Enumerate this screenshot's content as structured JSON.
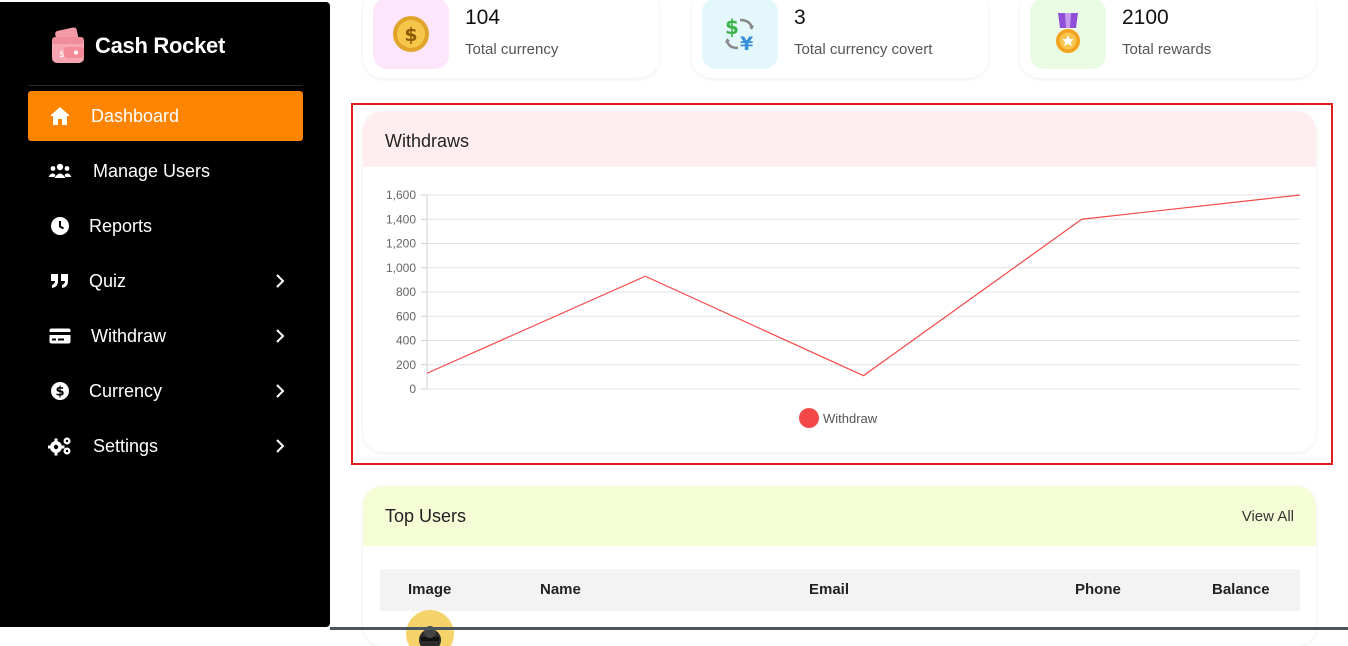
{
  "brand": {
    "name": "Cash Rocket",
    "logo_icon": "wallet-logo-icon"
  },
  "sidebar": {
    "items": [
      {
        "label": "Dashboard",
        "icon": "home-icon",
        "active": true,
        "has_submenu": false
      },
      {
        "label": "Manage Users",
        "icon": "users-icon",
        "active": false,
        "has_submenu": false
      },
      {
        "label": "Reports",
        "icon": "clock-icon",
        "active": false,
        "has_submenu": false
      },
      {
        "label": "Quiz",
        "icon": "quote-icon",
        "active": false,
        "has_submenu": true
      },
      {
        "label": "Withdraw",
        "icon": "credit-card-icon",
        "active": false,
        "has_submenu": true
      },
      {
        "label": "Currency",
        "icon": "dollar-circle-icon",
        "active": false,
        "has_submenu": true
      },
      {
        "label": "Settings",
        "icon": "gears-icon",
        "active": false,
        "has_submenu": true
      }
    ]
  },
  "stats": [
    {
      "value": "104",
      "label": "Total currency",
      "icon": "gold-coin-icon",
      "bg": "#fde6fb"
    },
    {
      "value": "3",
      "label": "Total currency covert",
      "icon": "currency-exchange-icon",
      "bg": "#e4f8fb"
    },
    {
      "value": "2100",
      "label": "Total rewards",
      "icon": "medal-icon",
      "bg": "#eafbe4"
    }
  ],
  "withdraws_panel": {
    "title": "Withdraws",
    "header_bg": "#ffedf0"
  },
  "chart_data": {
    "type": "line",
    "x": [
      1,
      2,
      3,
      4,
      5
    ],
    "series": [
      {
        "name": "Withdraw",
        "values": [
          130,
          930,
          110,
          1400,
          1600
        ],
        "color": "#f44848"
      }
    ],
    "yticks": [
      "1,600",
      "1,400",
      "1,200",
      "1,000",
      "800",
      "600",
      "400",
      "200",
      "0"
    ],
    "ylim": [
      0,
      1600
    ],
    "grid": true,
    "legend_placement": "bottom-center"
  },
  "top_users_panel": {
    "title": "Top Users",
    "view_all": "View All",
    "header_bg": "#f5fdd6",
    "columns": [
      "Image",
      "Name",
      "Email",
      "Phone",
      "Balance"
    ]
  },
  "colors": {
    "accent": "#ff8400",
    "sidebar_bg": "#000000",
    "highlight": "#e01b1b"
  }
}
